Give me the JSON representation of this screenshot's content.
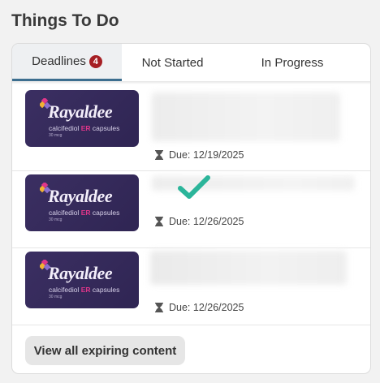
{
  "section": {
    "title": "Things To Do"
  },
  "tabs": [
    {
      "label": "Deadlines",
      "badge": "4",
      "active": true
    },
    {
      "label": "Not Started"
    },
    {
      "label": "In Progress"
    }
  ],
  "items": [
    {
      "thumbnail": {
        "brand": "Rayaldee",
        "subtitle_pre": "calcifediol ",
        "subtitle_er": "ER",
        "subtitle_post": " capsules",
        "dose": "30 mcg"
      },
      "due": "Due: 12/19/2025",
      "completed": false
    },
    {
      "thumbnail": {
        "brand": "Rayaldee",
        "subtitle_pre": "calcifediol ",
        "subtitle_er": "ER",
        "subtitle_post": " capsules",
        "dose": "30 mcg"
      },
      "due": "Due: 12/26/2025",
      "completed": true
    },
    {
      "thumbnail": {
        "brand": "Rayaldee",
        "subtitle_pre": "calcifediol ",
        "subtitle_er": "ER",
        "subtitle_post": " capsules",
        "dose": "30 mcg"
      },
      "due": "Due: 12/26/2025",
      "completed": false
    }
  ],
  "footer": {
    "view_all_label": "View all expiring content"
  },
  "icons": {
    "due": "hourglass-icon",
    "completed": "checkmark-icon"
  },
  "colors": {
    "badge": "#a61f24",
    "active_tab_underline": "#3c6e8f",
    "checkmark": "#2bb59a",
    "thumbnail_bg": "#352a5b",
    "er_accent": "#e0368a"
  }
}
